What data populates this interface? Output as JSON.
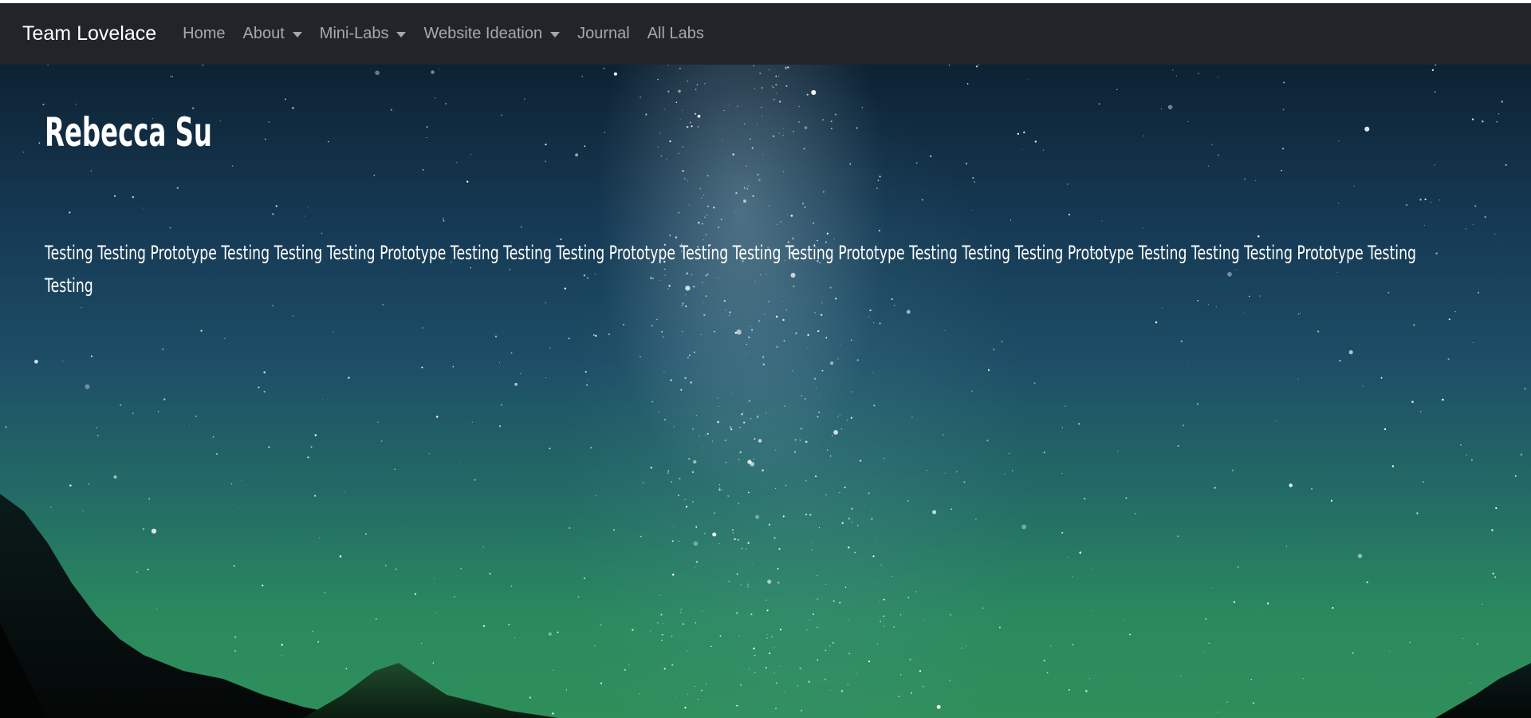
{
  "navbar": {
    "brand": "Team Lovelace",
    "items": [
      {
        "label": "Home",
        "dropdown": false
      },
      {
        "label": "About",
        "dropdown": true
      },
      {
        "label": "Mini-Labs",
        "dropdown": true
      },
      {
        "label": "Website Ideation",
        "dropdown": true
      },
      {
        "label": "Journal",
        "dropdown": false
      },
      {
        "label": "All Labs",
        "dropdown": false
      }
    ]
  },
  "hero": {
    "title": "Rebecca Su",
    "body": "Testing Testing Prototype Testing Testing Testing Prototype Testing Testing Testing Prototype Testing Testing Testing Prototype Testing Testing Testing Prototype Testing Testing Testing Prototype Testing Testing"
  },
  "colors": {
    "navbar_bg": "#212529",
    "nav_link": "#9a9da0",
    "brand": "#ffffff",
    "text": "#ffffff"
  },
  "icons": {
    "dropdown": "chevron-down-icon"
  }
}
